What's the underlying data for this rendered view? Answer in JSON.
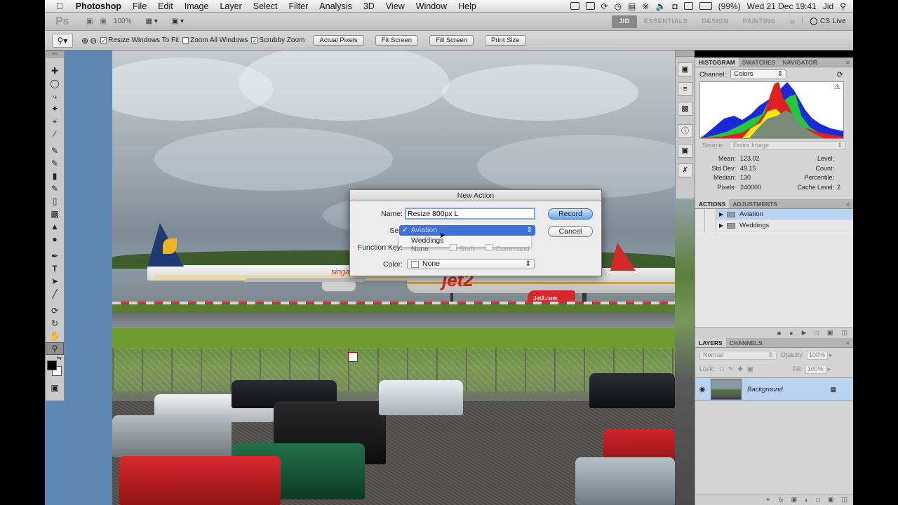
{
  "menubar": {
    "apple": "",
    "items": [
      "Photoshop",
      "File",
      "Edit",
      "Image",
      "Layer",
      "Select",
      "Filter",
      "Analysis",
      "3D",
      "View",
      "Window",
      "Help"
    ],
    "battery": "(99%)",
    "datetime": "Wed 21 Dec  19:41",
    "user": "Jid"
  },
  "appbar": {
    "logo": "Ps",
    "zoom": "100%",
    "workspaces": [
      "JID",
      "ESSENTIALS",
      "DESIGN",
      "PAINTING"
    ],
    "more": "»",
    "cslive": "CS Live"
  },
  "options": {
    "resize_windows": "Resize Windows To Fit",
    "zoom_all": "Zoom All Windows",
    "scrubby": "Scrubby Zoom",
    "actual_pixels": "Actual Pixels",
    "fit_screen": "Fit Screen",
    "fill_screen": "Fill Screen",
    "print_size": "Print Size"
  },
  "histogram": {
    "tabs": [
      "HISTOGRAM",
      "SWATCHES",
      "NAVIGATOR"
    ],
    "channel_label": "Channel:",
    "channel_value": "Colors",
    "source_label": "Source:",
    "source_value": "Entire Image",
    "mean_label": "Mean:",
    "mean": "123.02",
    "stddev_label": "Std Dev:",
    "stddev": "49.15",
    "median_label": "Median:",
    "median": "130",
    "pixels_label": "Pixels:",
    "pixels": "240000",
    "level_label": "Level:",
    "count_label": "Count:",
    "percentile_label": "Percentile:",
    "cache_label": "Cache Level:",
    "cache": "2"
  },
  "actions": {
    "tabs": [
      "ACTIONS",
      "ADJUSTMENTS"
    ],
    "sets": [
      "Aviation",
      "Weddings"
    ]
  },
  "layers": {
    "tabs": [
      "LAYERS",
      "CHANNELS"
    ],
    "blend_mode": "Normal",
    "opacity_label": "Opacity:",
    "opacity": "100%",
    "lock_label": "Lock:",
    "fill_label": "Fill:",
    "fill": "100%",
    "layer_name": "Background"
  },
  "dialog": {
    "title": "New Action",
    "name_label": "Name:",
    "name_value": "Resize 800px L",
    "set_label": "Set:",
    "set_selected": "Aviation",
    "set_option": "Weddings",
    "fkey_label": "Function Key:",
    "fkey_value": "None",
    "shift": "Shift",
    "command": "Command",
    "color_label": "Color:",
    "color_value": "None",
    "record": "Record",
    "cancel": "Cancel"
  },
  "photo": {
    "airline1": "singapore",
    "airline2": "jet2",
    "engine_text": "Jet2.com"
  },
  "colors": {
    "accent": "#5e87b3",
    "selection": "#b9d3f1",
    "record_button": "#6aa7ec"
  }
}
